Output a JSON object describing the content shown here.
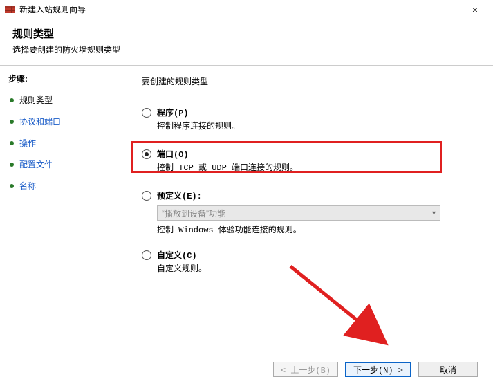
{
  "window": {
    "title": "新建入站规则向导",
    "close": "×"
  },
  "header": {
    "title": "规则类型",
    "subtitle": "选择要创建的防火墙规则类型"
  },
  "sidebar": {
    "steps_label": "步骤:",
    "items": [
      {
        "label": "规则类型"
      },
      {
        "label": "协议和端口"
      },
      {
        "label": "操作"
      },
      {
        "label": "配置文件"
      },
      {
        "label": "名称"
      }
    ]
  },
  "content": {
    "question": "要创建的规则类型",
    "options": {
      "program": {
        "label": "程序(P)",
        "desc": "控制程序连接的规则。"
      },
      "port": {
        "label": "端口(O)",
        "desc": "控制 TCP 或 UDP 端口连接的规则。"
      },
      "predefined": {
        "label": "预定义(E):",
        "dropdown": "“播放到设备”功能",
        "desc": "控制 Windows 体验功能连接的规则。"
      },
      "custom": {
        "label": "自定义(C)",
        "desc": "自定义规则。"
      }
    }
  },
  "footer": {
    "back": "< 上一步(B)",
    "next": "下一步(N) >",
    "cancel": "取消"
  }
}
